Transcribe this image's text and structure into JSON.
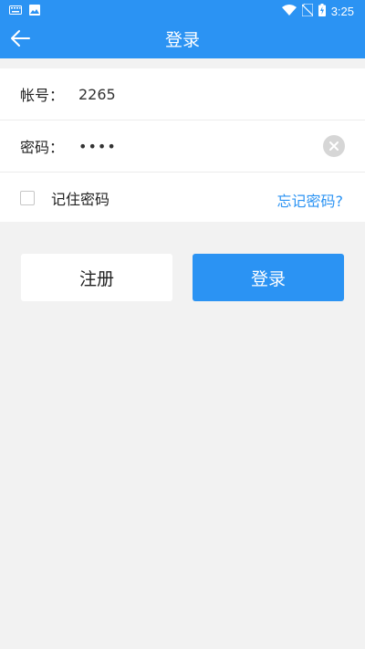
{
  "status_bar": {
    "time": "3:25",
    "left_icons": [
      "keyboard-icon",
      "image-icon"
    ],
    "right_icons": [
      "wifi-icon",
      "no-sim-icon",
      "battery-charging-icon"
    ]
  },
  "toolbar": {
    "title": "登录",
    "back_icon": "arrow-left-icon"
  },
  "form": {
    "account_label": "帐号：",
    "account_value": "2265",
    "password_label": "密码：",
    "password_value": "••••",
    "clear_icon": "clear-circle-icon",
    "remember_label": "记住密码",
    "remember_checked": false,
    "forgot_link": "忘记密码?"
  },
  "buttons": {
    "register": "注册",
    "login": "登录"
  },
  "colors": {
    "accent": "#2b93f3",
    "background": "#f2f2f2",
    "card": "#ffffff"
  }
}
